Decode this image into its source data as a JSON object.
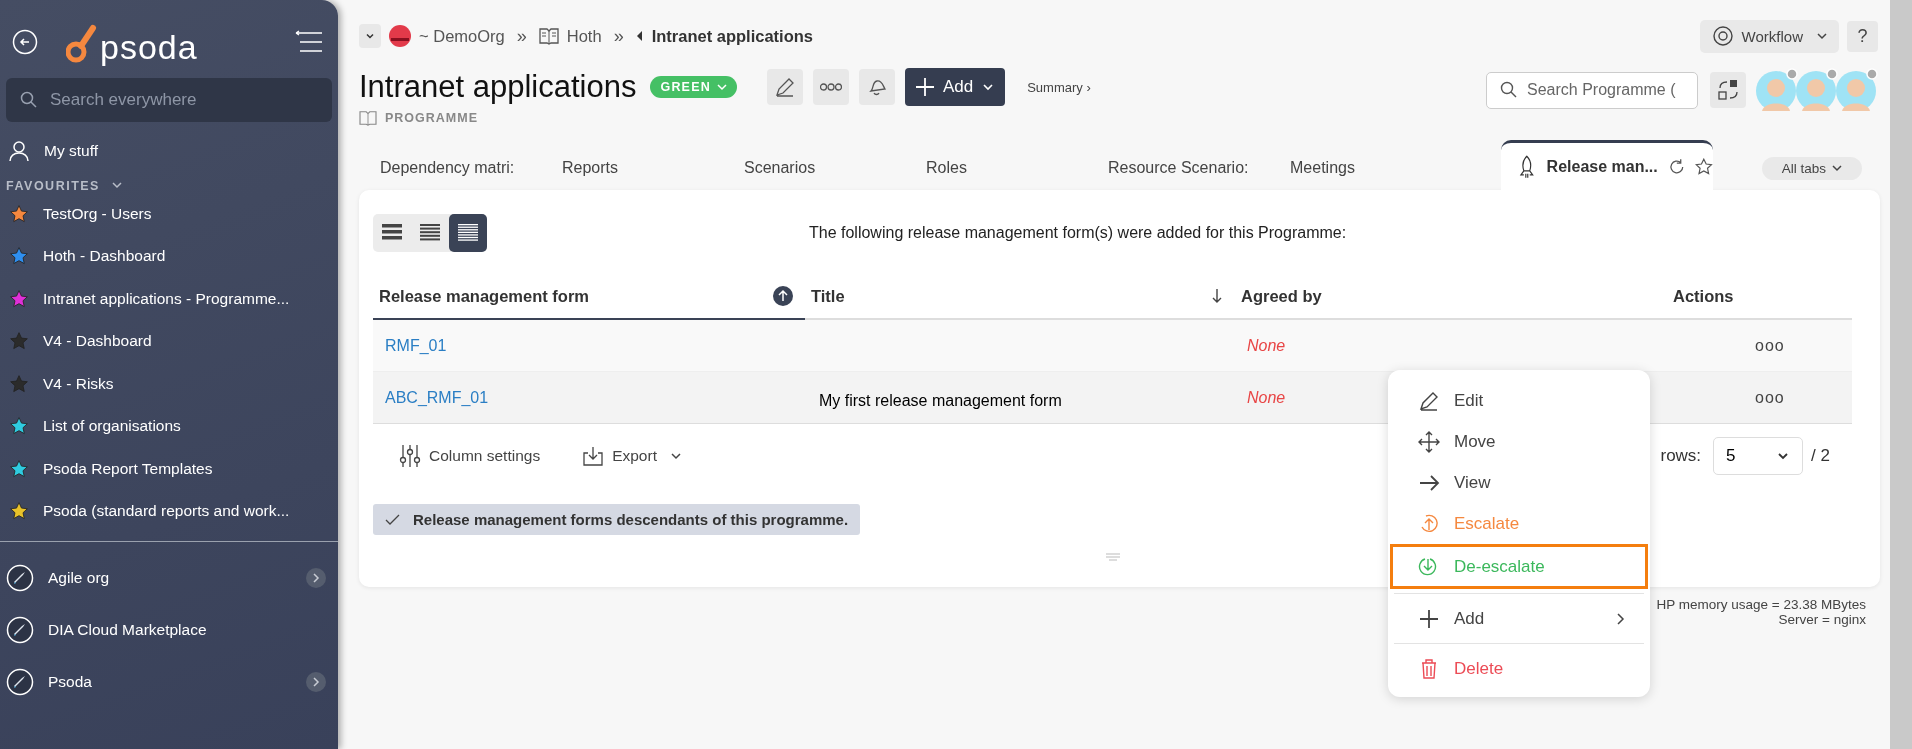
{
  "sidebar": {
    "logo": "psoda",
    "search": {
      "placeholder": "Search everywhere"
    },
    "my_stuff": "My stuff",
    "favourites_label": "FAVOURITES",
    "favourites": [
      {
        "label": "TestOrg - Users",
        "color": "#f5883f"
      },
      {
        "label": "Hoth - Dashboard",
        "color": "#2f8ff0"
      },
      {
        "label": "Intranet applications - Programme...",
        "color": "#e030d8"
      },
      {
        "label": "V4 - Dashboard",
        "color": "#2b2b2b"
      },
      {
        "label": "V4 - Risks",
        "color": "#2b2b2b"
      },
      {
        "label": "List of organisations",
        "color": "#2fcbe0"
      },
      {
        "label": "Psoda Report Templates",
        "color": "#2fcbe0"
      },
      {
        "label": "Psoda (standard reports and work...",
        "color": "#e8c22a"
      }
    ],
    "organisations": [
      {
        "label": "Agile org",
        "has_children": true
      },
      {
        "label": "DIA Cloud Marketplace",
        "has_children": false
      },
      {
        "label": "Psoda",
        "has_children": true
      }
    ]
  },
  "breadcrumb": [
    {
      "label": "~ DemoOrg",
      "kind": "org"
    },
    {
      "label": "»",
      "kind": "separator"
    },
    {
      "label": "Hoth",
      "kind": "book"
    },
    {
      "label": "»",
      "kind": "separator"
    },
    {
      "label": "Intranet applications",
      "kind": "current"
    }
  ],
  "header": {
    "title": "Intranet applications",
    "status": "GREEN",
    "type": "PROGRAMME",
    "add_label": "Add",
    "summary": "Summary ›",
    "workflow": "Workflow",
    "help": "?",
    "search": {
      "placeholder": "Search Programme ("
    },
    "avatars": [
      {
        "online": false
      },
      {
        "online": false
      },
      {
        "online": false
      }
    ]
  },
  "tabs": [
    {
      "label": "Dependency matri:",
      "selected": false
    },
    {
      "label": "Reports",
      "selected": false
    },
    {
      "label": "Scenarios",
      "selected": false
    },
    {
      "label": "Roles",
      "selected": false
    },
    {
      "label": "Resource Scenario:",
      "selected": false
    },
    {
      "label": "Meetings",
      "selected": false
    },
    {
      "label": "Release man...",
      "selected": true
    }
  ],
  "all_tabs": "All tabs",
  "view_modes": [
    {
      "selected": false
    },
    {
      "selected": false
    },
    {
      "selected": true
    }
  ],
  "intro": "The following release management form(s) were added for this Programme:",
  "table": {
    "columns": [
      {
        "label": "Release management form",
        "sorted": true
      },
      {
        "label": "Title",
        "sorted": false
      },
      {
        "label": "Agreed by"
      },
      {
        "label": "Actions"
      }
    ],
    "rows": [
      {
        "form": "RMF_01",
        "title": "",
        "agreed_by": "None",
        "actions": "ooo"
      },
      {
        "form": "ABC_RMF_01",
        "title": "My first release management form",
        "agreed_by": "None",
        "actions": "ooo"
      }
    ]
  },
  "footer": {
    "column_settings": "Column settings",
    "export": "Export",
    "rows_label": "rows:",
    "rows_value": "5",
    "pages": "/ 2"
  },
  "note": "Release management forms descendants of this programme.",
  "server_info": [
    "HP memory usage = 23.38 MBytes",
    "Server = nginx"
  ],
  "context_menu": [
    [
      {
        "label": "Edit",
        "kind": "edit",
        "selected": false
      },
      {
        "label": "Move",
        "kind": "move",
        "selected": false
      },
      {
        "label": "View",
        "kind": "view",
        "selected": false
      },
      {
        "label": "Escalate",
        "kind": "escalate",
        "selected": false
      },
      {
        "label": "De-escalate",
        "kind": "deescalate",
        "selected": true
      }
    ],
    [
      {
        "label": "Add",
        "kind": "add",
        "selected": false,
        "submenu": true
      }
    ],
    [
      {
        "label": "Delete",
        "kind": "delete",
        "selected": false
      }
    ]
  ]
}
